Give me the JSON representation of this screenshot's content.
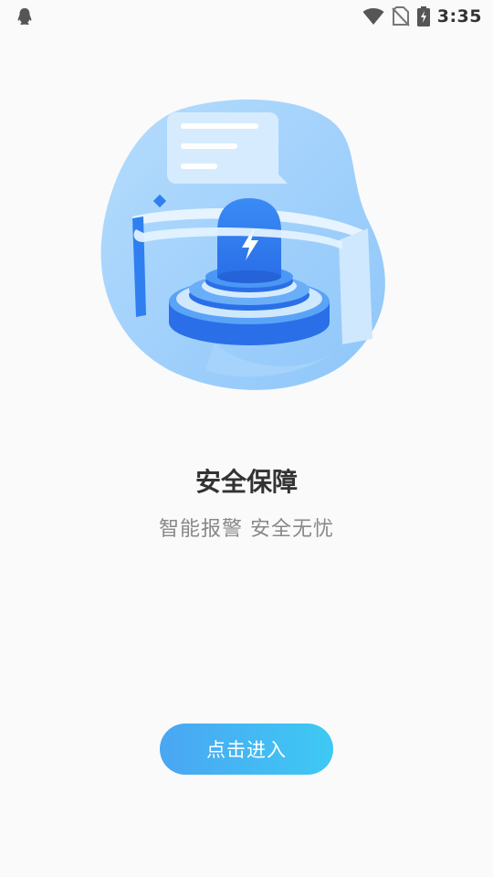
{
  "status_bar": {
    "time": "3:35",
    "icons": [
      "qq-penguin-icon",
      "wifi-icon",
      "no-sim-icon",
      "battery-charging-icon"
    ]
  },
  "hero": {
    "icon": "security-alarm-illustration",
    "colors": {
      "blob": "#9fd0fb",
      "accent": "#2f7ff0",
      "light": "#cfe8fd"
    }
  },
  "content": {
    "title": "安全保障",
    "subtitle": "智能报警 安全无忧"
  },
  "enter_button": {
    "label": "点击进入"
  }
}
